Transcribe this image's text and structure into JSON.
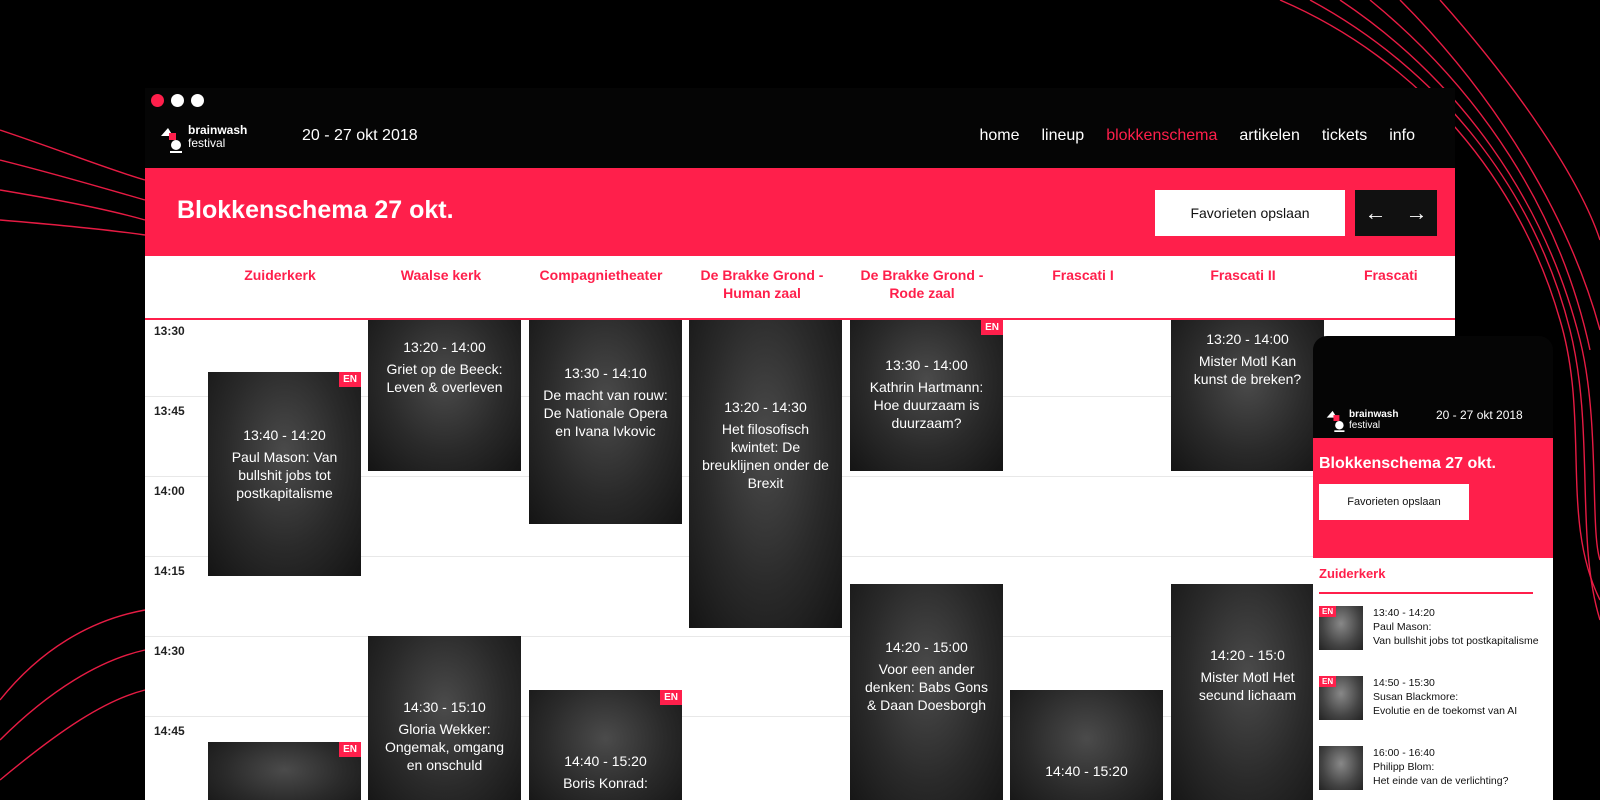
{
  "colors": {
    "accent": "#ff1f4b",
    "background": "#000000"
  },
  "window": {
    "dots": [
      "red",
      "white",
      "white"
    ]
  },
  "logo": {
    "line1": "brainwash",
    "line2": "festival"
  },
  "header": {
    "date": "20 - 27 okt 2018"
  },
  "nav": [
    {
      "label": "home",
      "active": false
    },
    {
      "label": "lineup",
      "active": false
    },
    {
      "label": "blokkenschema",
      "active": true
    },
    {
      "label": "artikelen",
      "active": false
    },
    {
      "label": "tickets",
      "active": false
    },
    {
      "label": "info",
      "active": false
    }
  ],
  "banner": {
    "title": "Blokkenschema 27 okt.",
    "save_label": "Favorieten opslaan",
    "prev_icon": "arrow-left-icon",
    "next_icon": "arrow-right-icon"
  },
  "venues": [
    "Zuiderkerk",
    "Waalse kerk",
    "Compagnietheater",
    "De Brakke Grond - Human zaal",
    "De Brakke Grond - Rode zaal",
    "Frascati I",
    "Frascati II",
    "Frascati"
  ],
  "times": [
    "13:30",
    "13:45",
    "14:00",
    "14:15",
    "14:30",
    "14:45"
  ],
  "events": [
    {
      "time": "13:40 - 14:20",
      "title": "Paul Mason: Van bullshit jobs tot postkapitalisme",
      "en": "EN"
    },
    {
      "time": "13:20 - 14:00",
      "title": "Griet op de Beeck: Leven & overleven",
      "en": ""
    },
    {
      "time": "13:30 - 14:10",
      "title": "De macht van rouw: De Nationale Opera en Ivana Ivkovic",
      "en": ""
    },
    {
      "time": "13:20 - 14:30",
      "title": "Het filosofisch kwintet: De breuklijnen onder de Brexit",
      "en": ""
    },
    {
      "time": "13:30 - 14:00",
      "title": "Kathrin Hartmann: Hoe duurzaam is duurzaam?",
      "en": "EN"
    },
    {
      "time": "13:20 - 14:00",
      "title": "Mister Motl Kan kunst de breken?",
      "en": ""
    },
    {
      "time": "14:30 - 15:10",
      "title": "Gloria Wekker: Ongemak, omgang en onschuld",
      "en": ""
    },
    {
      "time": "14:40 - 15:20",
      "title": "Boris Konrad:",
      "en": "EN"
    },
    {
      "time": "14:20 - 15:00",
      "title": "Voor een ander denken: Babs Gons & Daan Doesborgh",
      "en": ""
    },
    {
      "time": "14:40 - 15:20",
      "title": "",
      "en": ""
    },
    {
      "time": "14:20 - 15:0",
      "title": "Mister Motl Het secund lichaam",
      "en": ""
    },
    {
      "time": "",
      "title": "",
      "en": "EN"
    }
  ],
  "mobile": {
    "date": "20 - 27 okt 2018",
    "title": "Blokkenschema 27 okt.",
    "save_label": "Favorieten opslaan",
    "venue": "Zuiderkerk",
    "items": [
      {
        "time": "13:40 - 14:20",
        "speaker": "Paul Mason:",
        "title": "Van bullshit jobs tot postkapitalisme",
        "en": "EN"
      },
      {
        "time": "14:50 - 15:30",
        "speaker": "Susan Blackmore:",
        "title": "Evolutie en de toekomst van AI",
        "en": "EN"
      },
      {
        "time": "16:00 - 16:40",
        "speaker": "Philipp Blom:",
        "title": "Het einde van de verlichting?",
        "en": ""
      }
    ]
  }
}
